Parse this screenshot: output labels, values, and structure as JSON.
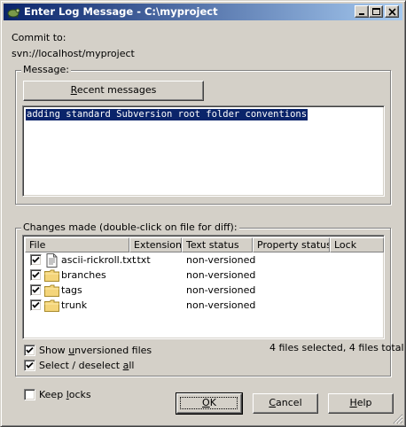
{
  "window": {
    "title": "Enter Log Message - C:\\myproject"
  },
  "commit": {
    "label": "Commit to:",
    "url": "svn://localhost/myproject"
  },
  "message": {
    "group_title": "Message:",
    "recent_button": "Recent messages",
    "text": "adding standard Subversion root folder conventions"
  },
  "changes": {
    "group_title": "Changes made (double-click on file for diff):",
    "columns": [
      "File",
      "Extension",
      "Text status",
      "Property status",
      "Lock"
    ],
    "rows": [
      {
        "file": "ascii-rickroll.txt",
        "extension": ".txt",
        "text_status": "non-versioned",
        "property_status": "",
        "lock": "",
        "checked": true,
        "icon": "text-file-icon"
      },
      {
        "file": "branches",
        "extension": "",
        "text_status": "non-versioned",
        "property_status": "",
        "lock": "",
        "checked": true,
        "icon": "folder-icon"
      },
      {
        "file": "tags",
        "extension": "",
        "text_status": "non-versioned",
        "property_status": "",
        "lock": "",
        "checked": true,
        "icon": "folder-icon"
      },
      {
        "file": "trunk",
        "extension": "",
        "text_status": "non-versioned",
        "property_status": "",
        "lock": "",
        "checked": true,
        "icon": "folder-icon"
      }
    ],
    "show_unversioned": {
      "label_pre": "Show ",
      "label_u": "u",
      "label_post": "nversioned files",
      "checked": true
    },
    "select_all": {
      "label_pre": "Select / deselect ",
      "label_u": "a",
      "label_post": "ll",
      "checked": true
    },
    "summary": "4 files selected, 4 files total"
  },
  "keep_locks": {
    "label_pre": "Keep ",
    "label_u": "l",
    "label_post": "ocks",
    "checked": false
  },
  "buttons": {
    "ok": {
      "u": "O",
      "rest": "K"
    },
    "cancel": {
      "pre": "",
      "u": "C",
      "rest": "ancel"
    },
    "help": {
      "u": "H",
      "rest": "elp"
    }
  },
  "colors": {
    "titlebar_start": "#0a246a",
    "titlebar_end": "#a6caf0",
    "selection": "#0a246a",
    "face": "#d4d0c8"
  }
}
